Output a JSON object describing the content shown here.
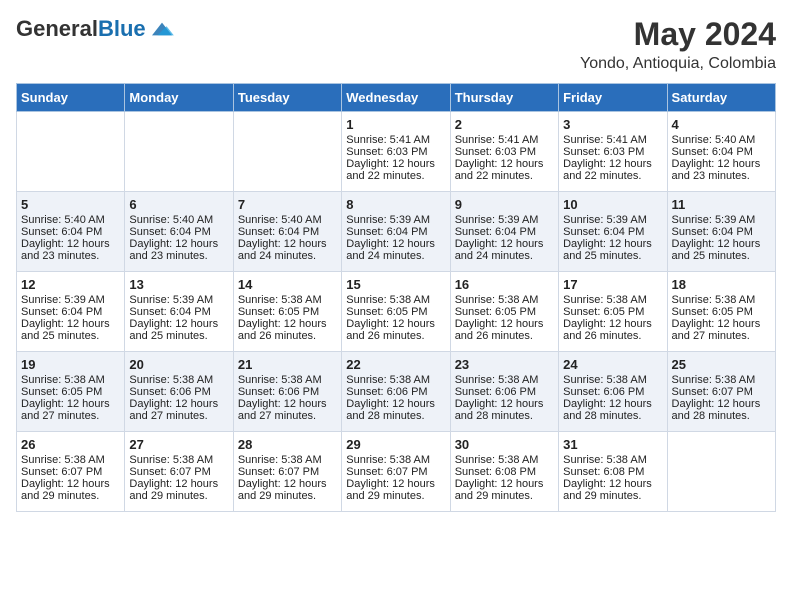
{
  "header": {
    "logo_general": "General",
    "logo_blue": "Blue",
    "main_title": "May 2024",
    "subtitle": "Yondo, Antioquia, Colombia"
  },
  "days_of_week": [
    "Sunday",
    "Monday",
    "Tuesday",
    "Wednesday",
    "Thursday",
    "Friday",
    "Saturday"
  ],
  "weeks": [
    [
      {
        "day": "",
        "content": ""
      },
      {
        "day": "",
        "content": ""
      },
      {
        "day": "",
        "content": ""
      },
      {
        "day": "1",
        "content": "Sunrise: 5:41 AM\nSunset: 6:03 PM\nDaylight: 12 hours\nand 22 minutes."
      },
      {
        "day": "2",
        "content": "Sunrise: 5:41 AM\nSunset: 6:03 PM\nDaylight: 12 hours\nand 22 minutes."
      },
      {
        "day": "3",
        "content": "Sunrise: 5:41 AM\nSunset: 6:03 PM\nDaylight: 12 hours\nand 22 minutes."
      },
      {
        "day": "4",
        "content": "Sunrise: 5:40 AM\nSunset: 6:04 PM\nDaylight: 12 hours\nand 23 minutes."
      }
    ],
    [
      {
        "day": "5",
        "content": "Sunrise: 5:40 AM\nSunset: 6:04 PM\nDaylight: 12 hours\nand 23 minutes."
      },
      {
        "day": "6",
        "content": "Sunrise: 5:40 AM\nSunset: 6:04 PM\nDaylight: 12 hours\nand 23 minutes."
      },
      {
        "day": "7",
        "content": "Sunrise: 5:40 AM\nSunset: 6:04 PM\nDaylight: 12 hours\nand 24 minutes."
      },
      {
        "day": "8",
        "content": "Sunrise: 5:39 AM\nSunset: 6:04 PM\nDaylight: 12 hours\nand 24 minutes."
      },
      {
        "day": "9",
        "content": "Sunrise: 5:39 AM\nSunset: 6:04 PM\nDaylight: 12 hours\nand 24 minutes."
      },
      {
        "day": "10",
        "content": "Sunrise: 5:39 AM\nSunset: 6:04 PM\nDaylight: 12 hours\nand 25 minutes."
      },
      {
        "day": "11",
        "content": "Sunrise: 5:39 AM\nSunset: 6:04 PM\nDaylight: 12 hours\nand 25 minutes."
      }
    ],
    [
      {
        "day": "12",
        "content": "Sunrise: 5:39 AM\nSunset: 6:04 PM\nDaylight: 12 hours\nand 25 minutes."
      },
      {
        "day": "13",
        "content": "Sunrise: 5:39 AM\nSunset: 6:04 PM\nDaylight: 12 hours\nand 25 minutes."
      },
      {
        "day": "14",
        "content": "Sunrise: 5:38 AM\nSunset: 6:05 PM\nDaylight: 12 hours\nand 26 minutes."
      },
      {
        "day": "15",
        "content": "Sunrise: 5:38 AM\nSunset: 6:05 PM\nDaylight: 12 hours\nand 26 minutes."
      },
      {
        "day": "16",
        "content": "Sunrise: 5:38 AM\nSunset: 6:05 PM\nDaylight: 12 hours\nand 26 minutes."
      },
      {
        "day": "17",
        "content": "Sunrise: 5:38 AM\nSunset: 6:05 PM\nDaylight: 12 hours\nand 26 minutes."
      },
      {
        "day": "18",
        "content": "Sunrise: 5:38 AM\nSunset: 6:05 PM\nDaylight: 12 hours\nand 27 minutes."
      }
    ],
    [
      {
        "day": "19",
        "content": "Sunrise: 5:38 AM\nSunset: 6:05 PM\nDaylight: 12 hours\nand 27 minutes."
      },
      {
        "day": "20",
        "content": "Sunrise: 5:38 AM\nSunset: 6:06 PM\nDaylight: 12 hours\nand 27 minutes."
      },
      {
        "day": "21",
        "content": "Sunrise: 5:38 AM\nSunset: 6:06 PM\nDaylight: 12 hours\nand 27 minutes."
      },
      {
        "day": "22",
        "content": "Sunrise: 5:38 AM\nSunset: 6:06 PM\nDaylight: 12 hours\nand 28 minutes."
      },
      {
        "day": "23",
        "content": "Sunrise: 5:38 AM\nSunset: 6:06 PM\nDaylight: 12 hours\nand 28 minutes."
      },
      {
        "day": "24",
        "content": "Sunrise: 5:38 AM\nSunset: 6:06 PM\nDaylight: 12 hours\nand 28 minutes."
      },
      {
        "day": "25",
        "content": "Sunrise: 5:38 AM\nSunset: 6:07 PM\nDaylight: 12 hours\nand 28 minutes."
      }
    ],
    [
      {
        "day": "26",
        "content": "Sunrise: 5:38 AM\nSunset: 6:07 PM\nDaylight: 12 hours\nand 29 minutes."
      },
      {
        "day": "27",
        "content": "Sunrise: 5:38 AM\nSunset: 6:07 PM\nDaylight: 12 hours\nand 29 minutes."
      },
      {
        "day": "28",
        "content": "Sunrise: 5:38 AM\nSunset: 6:07 PM\nDaylight: 12 hours\nand 29 minutes."
      },
      {
        "day": "29",
        "content": "Sunrise: 5:38 AM\nSunset: 6:07 PM\nDaylight: 12 hours\nand 29 minutes."
      },
      {
        "day": "30",
        "content": "Sunrise: 5:38 AM\nSunset: 6:08 PM\nDaylight: 12 hours\nand 29 minutes."
      },
      {
        "day": "31",
        "content": "Sunrise: 5:38 AM\nSunset: 6:08 PM\nDaylight: 12 hours\nand 29 minutes."
      },
      {
        "day": "",
        "content": ""
      }
    ]
  ]
}
